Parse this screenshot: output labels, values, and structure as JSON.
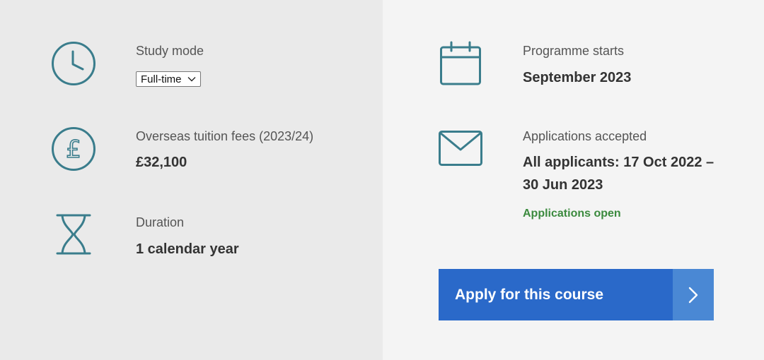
{
  "study_mode": {
    "label": "Study mode",
    "selected": "Full-time",
    "icon": "clock-icon"
  },
  "fees": {
    "label": "Overseas tuition fees (2023/24)",
    "value": "£32,100",
    "icon": "pound-icon"
  },
  "duration": {
    "label": "Duration",
    "value": "1 calendar year",
    "icon": "hourglass-icon"
  },
  "programme_start": {
    "label": "Programme starts",
    "value": "September 2023",
    "icon": "calendar-icon"
  },
  "applications": {
    "label": "Applications accepted",
    "value_line1": "All applicants: 17 Oct 2022 –",
    "value_line2": "30 Jun 2023",
    "status": "Applications open",
    "icon": "envelope-icon"
  },
  "apply_button": {
    "label": "Apply for this course",
    "icon": "chevron-right-icon"
  },
  "colors": {
    "icon_teal": "#3a7d8c",
    "button_blue": "#2a69c9",
    "button_arrow_blue": "#4a88d4",
    "status_green": "#3b8a3e",
    "left_bg": "#eaeaea",
    "right_bg": "#f4f4f4"
  }
}
